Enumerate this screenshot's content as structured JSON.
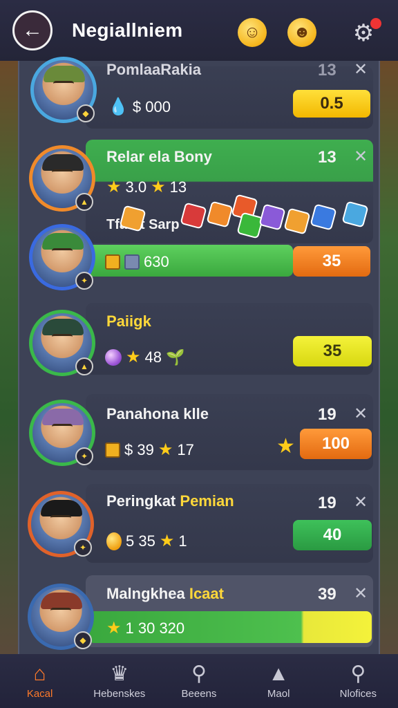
{
  "header": {
    "title": "Negiallniem",
    "back_icon": "arrow-left-icon",
    "emoji_1": "smile-face-icon",
    "emoji_2": "wink-face-icon",
    "settings_icon": "gear-icon"
  },
  "players": [
    {
      "name": "PomlaaRakia",
      "number": "13",
      "currency": "$ 000",
      "badge": "0.5",
      "badge_color": "yellow"
    },
    {
      "name": "Relar ela Bony",
      "number": "13",
      "stats": "3.0",
      "stats2": "13",
      "sub": "Tfafbt Sarp"
    },
    {
      "name": "",
      "stats": "630",
      "badge": "35",
      "badge_color": "orange"
    },
    {
      "name": "Paiigk",
      "stats": "48",
      "badge": "35",
      "badge_color": "lime"
    },
    {
      "name": "Panahona klle",
      "number": "19",
      "currency": "$ 39",
      "stats2": "17",
      "badge": "100",
      "badge_color": "orange"
    },
    {
      "name_white": "Peringkat",
      "name_yellow": "Pemian",
      "number": "19",
      "currency": "5 35",
      "stats2": "1",
      "badge": "40",
      "badge_color": "green"
    },
    {
      "name_white": "Malngkhea",
      "name_yellow": "Icaat",
      "number": "39",
      "stats": "1 30 320"
    }
  ],
  "nav": [
    {
      "label": "Kacal",
      "icon": "home-icon"
    },
    {
      "label": "Hebenskes",
      "icon": "cat-icon"
    },
    {
      "label": "Beeens",
      "icon": "search-icon"
    },
    {
      "label": "Maol",
      "icon": "map-pin-icon"
    },
    {
      "label": "Nlofices",
      "icon": "magnifier-icon"
    }
  ]
}
